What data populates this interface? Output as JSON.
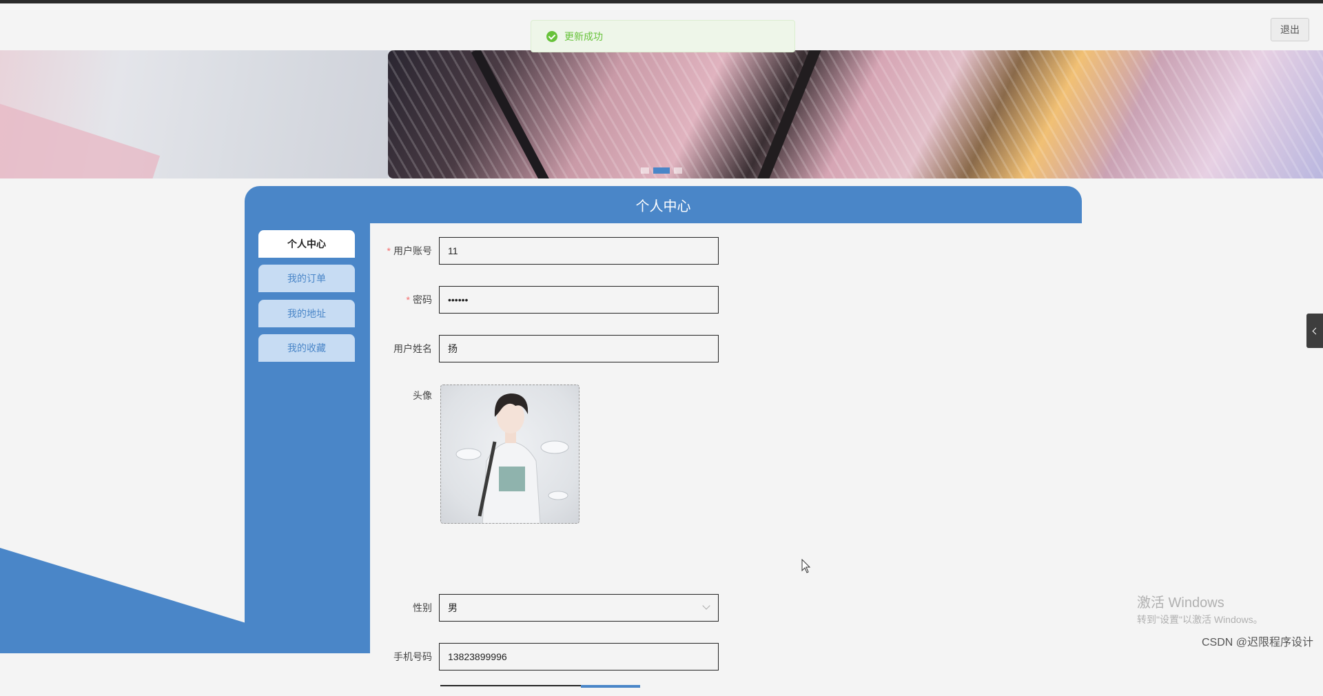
{
  "header": {
    "logout_label": "退出"
  },
  "toast": {
    "message": "更新成功"
  },
  "banner": {
    "active_slide": 2,
    "slide_count": 3
  },
  "panel": {
    "title": "个人中心"
  },
  "sidebar": {
    "items": [
      {
        "label": "个人中心",
        "active": true
      },
      {
        "label": "我的订单"
      },
      {
        "label": "我的地址"
      },
      {
        "label": "我的收藏"
      }
    ]
  },
  "form": {
    "account": {
      "label": "用户账号",
      "value": "11",
      "required": true
    },
    "password": {
      "label": "密码",
      "value": "••••••",
      "required": true
    },
    "name": {
      "label": "用户姓名",
      "value": "扬"
    },
    "avatar": {
      "label": "头像"
    },
    "gender": {
      "label": "性别",
      "value": "男"
    },
    "phone": {
      "label": "手机号码",
      "value": "13823899996"
    }
  },
  "watermark": {
    "title": "激活 Windows",
    "subtitle": "转到\"设置\"以激活 Windows。"
  },
  "footer": {
    "csdn": "CSDN @迟限程序设计"
  },
  "colors": {
    "primary": "#4a86c8",
    "success": "#67c23a",
    "required": "#f56c6c"
  }
}
